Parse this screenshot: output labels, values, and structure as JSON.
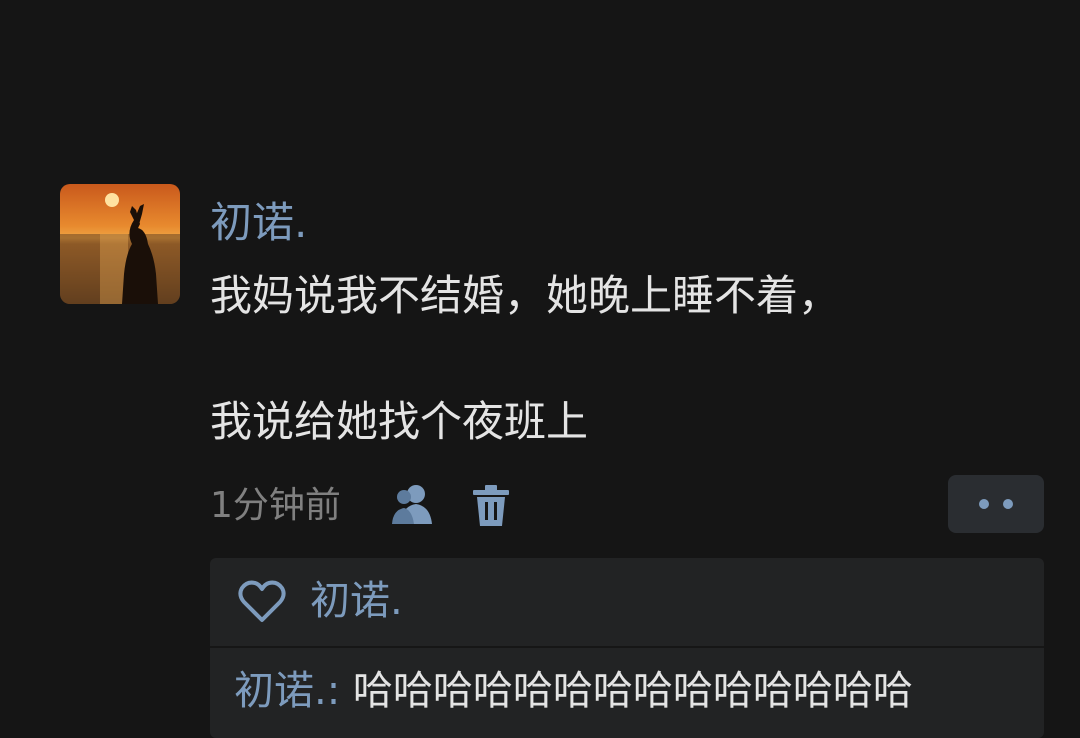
{
  "post": {
    "username": "初诺.",
    "content_line1": "我妈说我不结婚，她晚上睡不着，",
    "content_line2": "我说给她找个夜班上",
    "time": "1分钟前"
  },
  "likes": {
    "names": "初诺."
  },
  "comment": {
    "author": "初诺.",
    "separator": ":",
    "text": " 哈哈哈哈哈哈哈哈哈哈哈哈哈哈"
  },
  "colors": {
    "background": "#151515",
    "accent_name": "#7d9bbd",
    "text_primary": "#e4e4e4",
    "text_secondary": "#808080",
    "panel": "#222324",
    "more_button": "#2a2d31"
  },
  "icons": {
    "avatar": "sunset-silhouette-avatar",
    "privacy": "user-icon",
    "delete": "trash-icon",
    "more": "more-dots-icon",
    "like": "heart-icon"
  }
}
